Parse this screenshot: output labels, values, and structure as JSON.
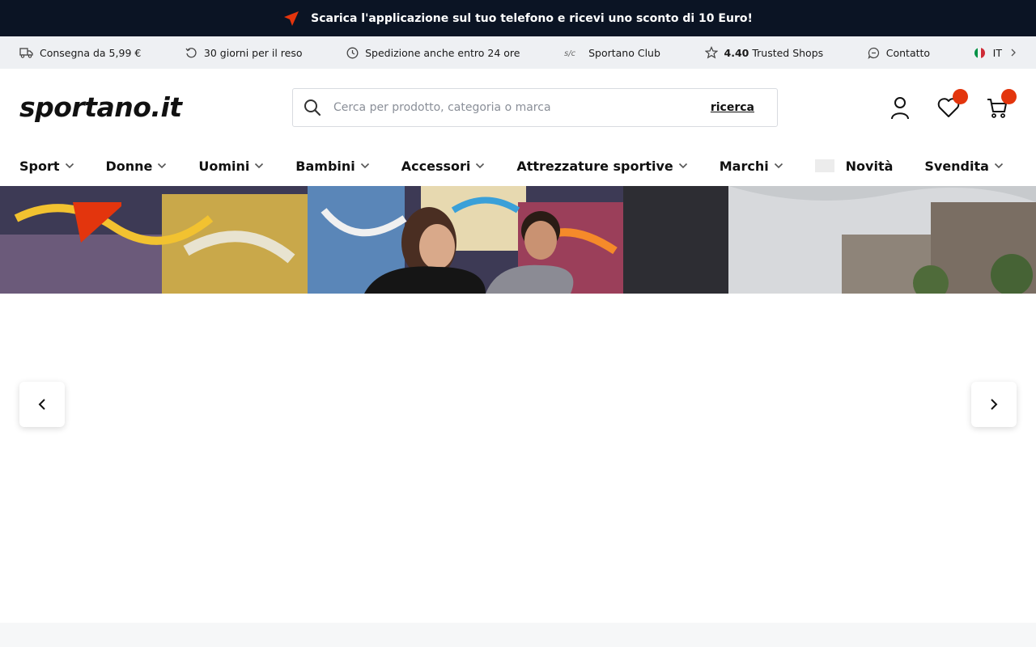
{
  "promo": {
    "text": "Scarica l'applicazione sul tuo telefono e ricevi uno sconto di 10 Euro!"
  },
  "usp": {
    "items": [
      {
        "label": "Consegna da 5,99 €",
        "icon": "truck-icon"
      },
      {
        "label": "30 giorni per il reso",
        "icon": "return-icon"
      },
      {
        "label": "Spedizione anche entro 24 ore",
        "icon": "clock-icon"
      },
      {
        "label": "Sportano Club",
        "icon": "club-icon"
      },
      {
        "rating": "4.40",
        "label": "Trusted Shops",
        "icon": "star-icon"
      },
      {
        "label": "Contatto",
        "icon": "chat-icon"
      }
    ],
    "language": "IT"
  },
  "header": {
    "logo": "sportano.it",
    "search": {
      "placeholder": "Cerca per prodotto, categoria o marca",
      "button": "ricerca"
    }
  },
  "nav": {
    "items": [
      "Sport",
      "Donne",
      "Uomini",
      "Bambini",
      "Accessori",
      "Attrezzature sportive",
      "Marchi",
      "Novità",
      "Svendita"
    ]
  },
  "colors": {
    "accent": "#e3350d",
    "dark": "#0b1424",
    "strip": "#eef0f3"
  }
}
